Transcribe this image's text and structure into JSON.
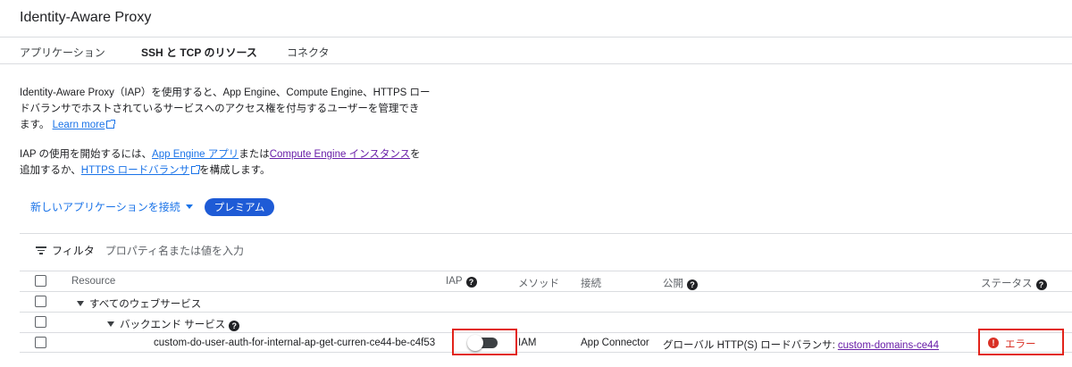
{
  "header": {
    "title": "Identity-Aware Proxy"
  },
  "tabs": [
    {
      "label": "アプリケーション"
    },
    {
      "label": "SSH と TCP のリソース"
    },
    {
      "label": "コネクタ"
    }
  ],
  "description": {
    "line1": "Identity-Aware Proxy（IAP）を使用すると、App Engine、Compute Engine、HTTPS ロー",
    "line2": "ドバランサでホストされているサービスへのアクセス権を付与するユーザーを管理でき",
    "line3": "ます。",
    "learn_more": "Learn more"
  },
  "start": {
    "text1": "IAP の使用を開始するには、",
    "app_engine_link": "App Engine アプリ",
    "text2": "または",
    "compute_link": "Compute Engine インスタンス",
    "text3": "を",
    "text4": "追加するか、",
    "https_link": "HTTPS ロードバランサ",
    "text5": "を構成します。"
  },
  "actions": {
    "connect_label": "新しいアプリケーションを接続",
    "premium_label": "プレミアム"
  },
  "filter": {
    "label": "フィルタ",
    "placeholder": "プロパティ名または値を入力"
  },
  "table": {
    "columns": {
      "resource": "Resource",
      "iap": "IAP",
      "method": "メソッド",
      "connection": "接続",
      "published": "公開",
      "status": "ステータス"
    },
    "groups": {
      "all_web": "すべてのウェブサービス",
      "backend": "バックエンド サービス"
    },
    "row": {
      "resource": "custom-do-user-auth-for-internal-ap-get-curren-ce44-be-c4f53",
      "iap_enabled": false,
      "method": "IAM",
      "connection": "App Connector",
      "published_prefix": "グローバル HTTP(S) ロードバランサ:",
      "published_link": "custom-domains-ce44",
      "status": "エラー"
    }
  },
  "colors": {
    "link": "#1a73e8",
    "visited_link": "#681da8",
    "premium_bg": "#1e5bd6",
    "error": "#d93025",
    "highlight_box": "#e2231a"
  }
}
